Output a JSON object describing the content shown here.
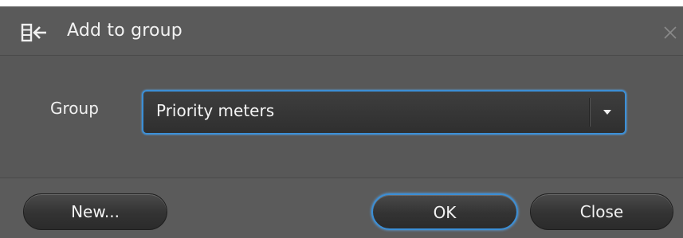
{
  "dialog": {
    "title": "Add to group",
    "title_icon": "add-to-group-icon",
    "close_icon": "close-icon"
  },
  "form": {
    "group_label": "Group",
    "group_select": {
      "selected": "Priority meters"
    }
  },
  "buttons": {
    "new_label": "New...",
    "ok_label": "OK",
    "close_label": "Close"
  },
  "colors": {
    "background": "#5b5b5b",
    "focus_accent": "#3c8fd6",
    "text": "#f2f2f2"
  }
}
